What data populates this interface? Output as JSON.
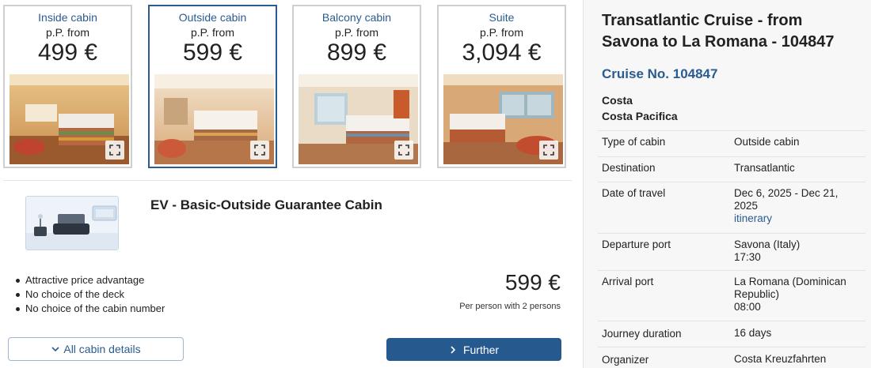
{
  "cabins": [
    {
      "type": "Inside cabin",
      "from_label": "p.P. from",
      "price": "499 €",
      "selected": false
    },
    {
      "type": "Outside cabin",
      "from_label": "p.P. from",
      "price": "599 €",
      "selected": true
    },
    {
      "type": "Balcony cabin",
      "from_label": "p.P. from",
      "price": "899 €",
      "selected": false
    },
    {
      "type": "Suite",
      "from_label": "p.P. from",
      "price": "3,094 €",
      "selected": false
    }
  ],
  "selected_cabin": {
    "title": "EV - Basic-Outside Guarantee Cabin",
    "features": [
      "Attractive price advantage",
      "No choice of the deck",
      "No choice of the cabin number"
    ],
    "price": "599 €",
    "price_note": "Per person with 2 persons"
  },
  "buttons": {
    "details": "All cabin details",
    "further": "Further"
  },
  "summary": {
    "title": "Transatlantic Cruise - from Savona to La Romana - 104847",
    "cruise_no": "Cruise No. 104847",
    "line": "Costa",
    "ship": "Costa Pacifica",
    "rows": {
      "type_of_cabin": {
        "label": "Type of cabin",
        "value": "Outside cabin"
      },
      "destination": {
        "label": "Destination",
        "value": "Transatlantic"
      },
      "date_of_travel": {
        "label": "Date of travel",
        "value": "Dec 6, 2025 - Dec 21, 2025",
        "link": "itinerary"
      },
      "departure_port": {
        "label": "Departure port",
        "value": "Savona (Italy)",
        "time": "17:30"
      },
      "arrival_port": {
        "label": "Arrival port",
        "value": "La Romana (Dominican Republic)",
        "time": "08:00"
      },
      "journey_duration": {
        "label": "Journey duration",
        "value": "16 days"
      },
      "organizer": {
        "label": "Organizer",
        "value": "Costa Kreuzfahrten"
      }
    }
  },
  "colors": {
    "accent": "#2a5b92",
    "button_primary": "#265a8f",
    "card_border": "#cfcfcf",
    "panel_bg": "#f7f7f7"
  },
  "icons": {
    "expand": "expand-icon",
    "chevron_down": "chevron-down-icon",
    "chevron_right": "chevron-right-icon"
  }
}
